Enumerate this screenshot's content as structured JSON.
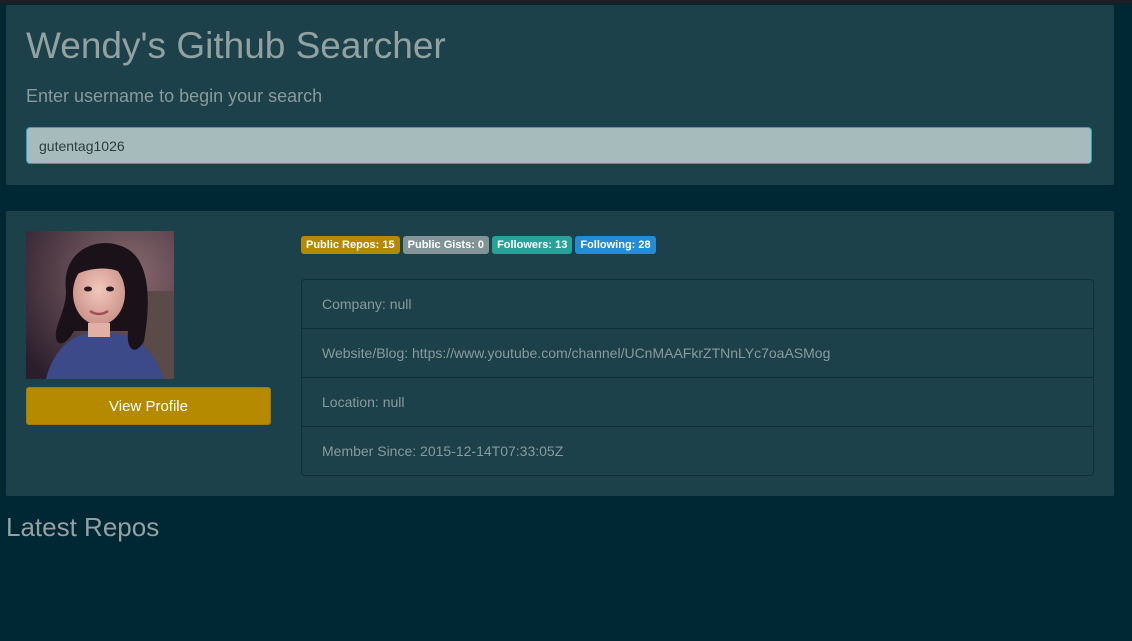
{
  "header": {
    "title": "Wendy's Github Searcher",
    "subtitle": "Enter username to begin your search"
  },
  "search": {
    "value": "gutentag1026"
  },
  "profile": {
    "avatar_alt": "avatar",
    "view_profile_label": "View Profile",
    "badges": [
      {
        "label": "Public Repos: 15",
        "color": "#b58900"
      },
      {
        "label": "Public Gists: 0",
        "color": "#839496"
      },
      {
        "label": "Followers: 13",
        "color": "#2aa198"
      },
      {
        "label": "Following: 28",
        "color": "#268bd2"
      }
    ],
    "details": [
      "Company: null",
      "Website/Blog: https://www.youtube.com/channel/UCnMAAFkrZTNnLYc7oaASMog",
      "Location: null",
      "Member Since: 2015-12-14T07:33:05Z"
    ]
  },
  "repos": {
    "heading": "Latest Repos"
  },
  "colors": {
    "background": "#002834",
    "panel": "#1c414a",
    "accent": "#b58900",
    "text": "#93a1a1"
  }
}
